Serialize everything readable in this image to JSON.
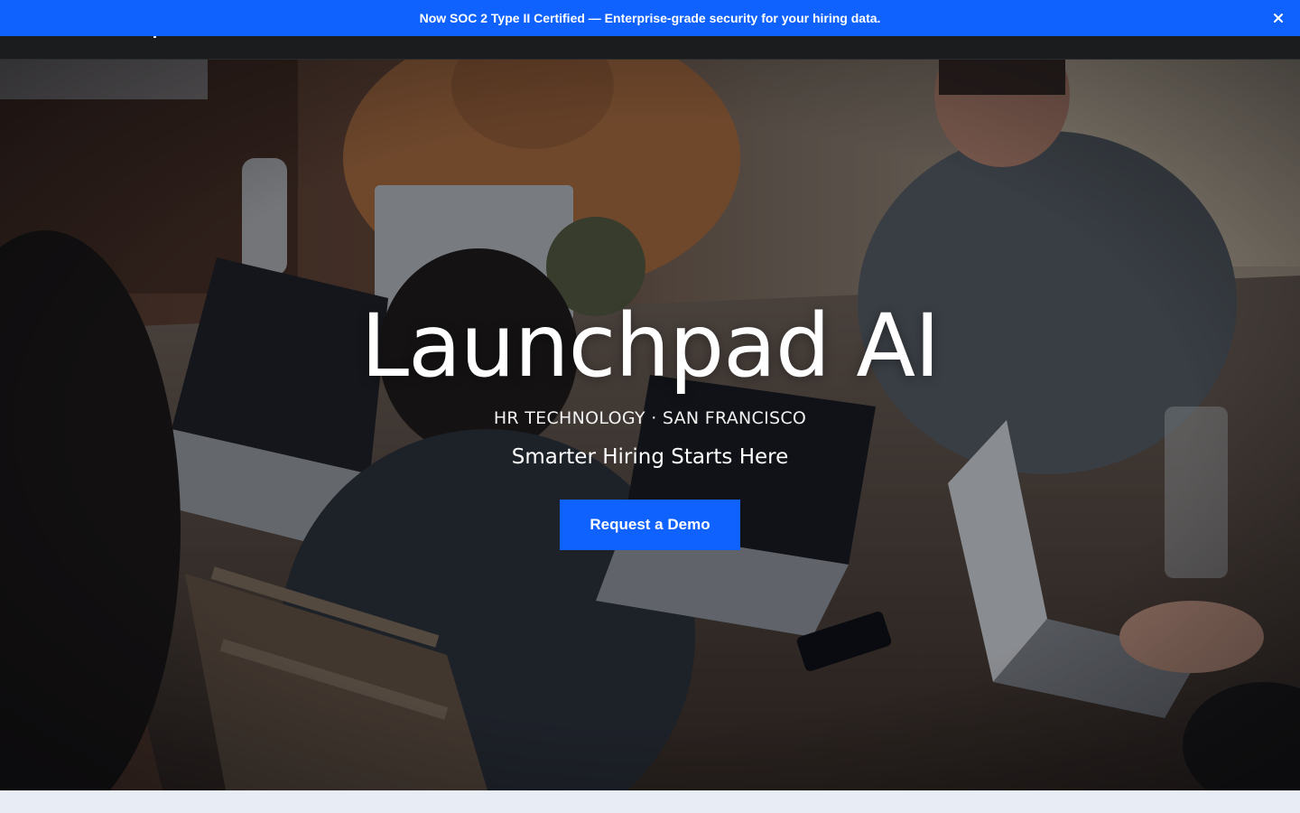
{
  "announcement": {
    "text": "Now SOC 2 Type II Certified — Enterprise-grade security for your hiring data.",
    "close_icon": "close-icon",
    "close_glyph": "×"
  },
  "hero": {
    "title": "Launchpad AI",
    "eyebrow": "HR TECHNOLOGY · SAN FRANCISCO",
    "tagline": "Smarter Hiring Starts Here",
    "cta_label": "Request a Demo",
    "background_image": "photo of people working on laptops around a wooden table"
  },
  "colors": {
    "accent": "#0f62fe",
    "nav_background": "#1b1c1e",
    "page_background": "#e8ecf4"
  }
}
